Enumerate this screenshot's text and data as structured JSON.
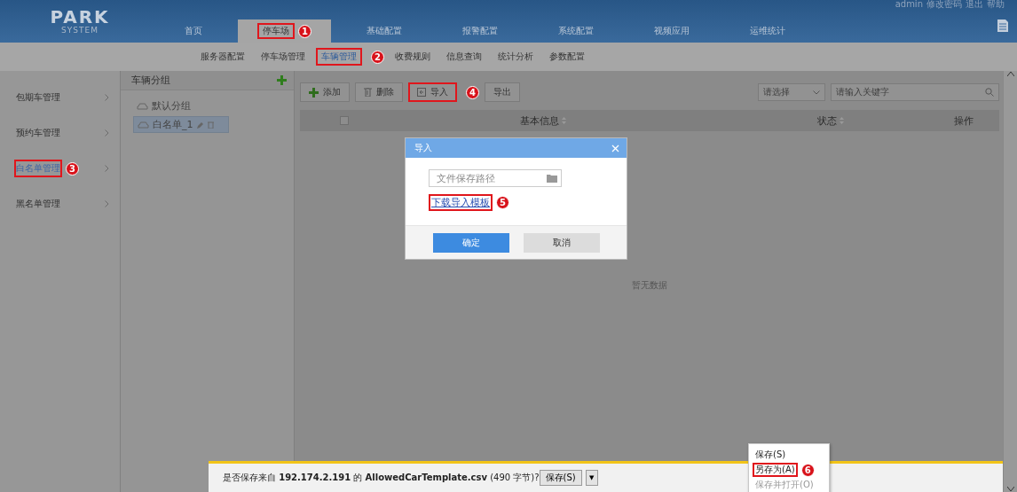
{
  "header": {
    "logo": {
      "title": "PARK",
      "subtitle": "SYSTEM"
    },
    "nav": [
      {
        "label": "首页",
        "selected": false,
        "highlighted": false
      },
      {
        "label": "停车场",
        "selected": true,
        "highlighted": true,
        "annotation": "1"
      },
      {
        "label": "基础配置",
        "selected": false,
        "highlighted": false
      },
      {
        "label": "报警配置",
        "selected": false,
        "highlighted": false
      },
      {
        "label": "系统配置",
        "selected": false,
        "highlighted": false
      },
      {
        "label": "视频应用",
        "selected": false,
        "highlighted": false
      },
      {
        "label": "运维统计",
        "selected": false,
        "highlighted": false
      }
    ],
    "user_links": [
      "admin",
      "修改密码",
      "退出",
      "帮助"
    ]
  },
  "subnav": [
    {
      "label": "服务器配置",
      "selected": false,
      "highlighted": false
    },
    {
      "label": "停车场管理",
      "selected": false,
      "highlighted": false
    },
    {
      "label": "车辆管理",
      "selected": true,
      "highlighted": true,
      "annotation": "2"
    },
    {
      "label": "收费规则",
      "selected": false,
      "highlighted": false
    },
    {
      "label": "信息查询",
      "selected": false,
      "highlighted": false
    },
    {
      "label": "统计分析",
      "selected": false,
      "highlighted": false
    },
    {
      "label": "参数配置",
      "selected": false,
      "highlighted": false
    }
  ],
  "sidebar": {
    "items": [
      {
        "label": "包期车管理",
        "selected": false,
        "highlighted": false
      },
      {
        "label": "预约车管理",
        "selected": false,
        "highlighted": false
      },
      {
        "label": "白名单管理",
        "selected": true,
        "highlighted": true,
        "annotation": "3"
      },
      {
        "label": "黑名单管理",
        "selected": false,
        "highlighted": false
      }
    ]
  },
  "groups": {
    "title": "车辆分组",
    "items": [
      {
        "label": "默认分组",
        "selected": false
      },
      {
        "label": "白名单_1",
        "selected": true
      }
    ]
  },
  "toolbar": {
    "buttons": [
      {
        "kind": "add",
        "label": "添加",
        "highlighted": false
      },
      {
        "kind": "delete",
        "label": "删除",
        "highlighted": false
      },
      {
        "kind": "import",
        "label": "导入",
        "highlighted": true,
        "annotation": "4"
      },
      {
        "kind": "export",
        "label": "导出",
        "highlighted": false
      }
    ],
    "select": {
      "placeholder": "请选择"
    },
    "search": {
      "placeholder": "请输入关键字"
    }
  },
  "table": {
    "select_all": {
      "checked": false
    },
    "columns": [
      "基本信息",
      "状态",
      "操作"
    ],
    "empty_text": "暂无数据"
  },
  "dialog": {
    "title": "导入",
    "field": {
      "placeholder": "文件保存路径"
    },
    "link": {
      "label": "下载导入模板",
      "highlighted": true,
      "annotation": "5"
    },
    "buttons": [
      {
        "label": "确定",
        "kind": "primary"
      },
      {
        "label": "取消",
        "kind": "secondary"
      }
    ]
  },
  "download_bar": {
    "message": "是否保存来自 **192.174.2.191** 的 **AllowedCarTemplate.csv** (490 字节)?",
    "button": "保存(S)",
    "arrow": "▼"
  },
  "context_menu": {
    "items": [
      {
        "label": "保存(S)",
        "disabled": false,
        "highlighted": false
      },
      {
        "label": "另存为(A)",
        "disabled": false,
        "highlighted": true,
        "annotation": "6"
      },
      {
        "label": "保存并打开(O)",
        "disabled": true,
        "highlighted": false
      }
    ]
  }
}
